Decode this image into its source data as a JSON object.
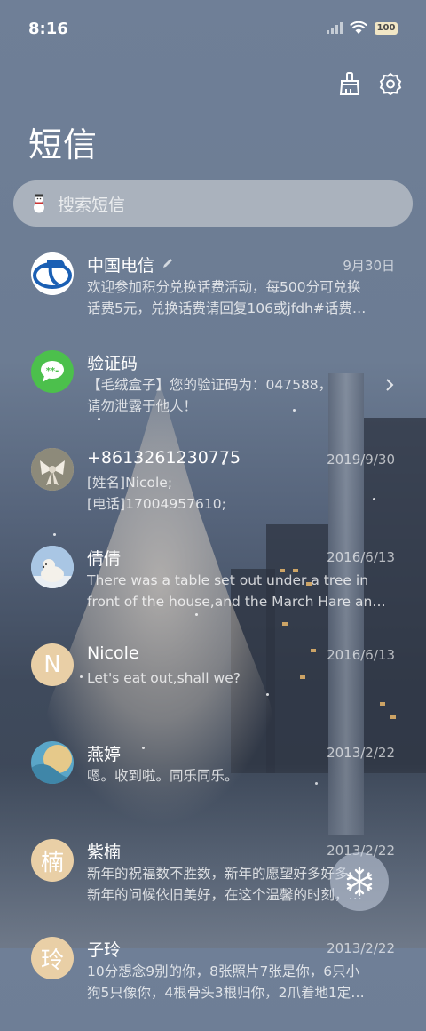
{
  "status_bar": {
    "time": "8:16",
    "battery": "100"
  },
  "header": {
    "title": "短信",
    "cleanup_icon": "brush-icon",
    "settings_icon": "gear-icon"
  },
  "search": {
    "placeholder": "搜索短信",
    "icon": "snowman-icon"
  },
  "messages": [
    {
      "name": "中国电信",
      "edit_icon": "pencil-icon",
      "date": "9月30日",
      "preview_line1": "欢迎参加积分兑换话费活动，每500分可兑换",
      "preview_line2": "话费5元，兑换话费请回复106或jfdh#话费…",
      "avatar": "china-telecom-logo"
    },
    {
      "name": "验证码",
      "date": "",
      "preview_line1": "【毛绒盒子】您的验证码为：047588，",
      "preview_line2": "请勿泄露于他人！",
      "avatar": "message-bubble-icon"
    },
    {
      "name": "+8613261230775",
      "date": "2019/9/30",
      "preview_line1": "[姓名]Nicole;",
      "preview_line2": "[电话]17004957610;",
      "avatar": "photo-bow"
    },
    {
      "name": "倩倩",
      "date": "2016/6/13",
      "preview_line1": "There was a table set out under a tree in",
      "preview_line2": "front of the house,and the March Hare an…",
      "avatar": "photo-polar-bear"
    },
    {
      "name": "Nicole",
      "date": "2016/6/13",
      "preview_line1": "Let's eat out,shall we?",
      "preview_line2": "",
      "avatar_text": "N"
    },
    {
      "name": "燕婷",
      "date": "2013/2/22",
      "preview_line1": "嗯。收到啦。同乐同乐。",
      "preview_line2": "",
      "avatar": "photo-landscape"
    },
    {
      "name": "紫楠",
      "date": "2013/2/22",
      "preview_line1": "新年的祝福数不胜数，新年的愿望好多好多，",
      "preview_line2": "新年的问候依旧美好，在这个温馨的时刻，…",
      "avatar_text": "楠"
    },
    {
      "name": "子玲",
      "date": "2013/2/22",
      "preview_line1": "10分想念9别的你，8张照片7张是你，6只小",
      "preview_line2": "狗5只像你，4根骨头3根归你，2爪着地1定…",
      "avatar_text": "玲"
    }
  ],
  "fab": {
    "icon": "snowflake-icon"
  },
  "colors": {
    "avatar_text_bg": "#e9cfa6",
    "telecom_blue": "#1a5fb4",
    "message_green": "#4cc04c"
  }
}
